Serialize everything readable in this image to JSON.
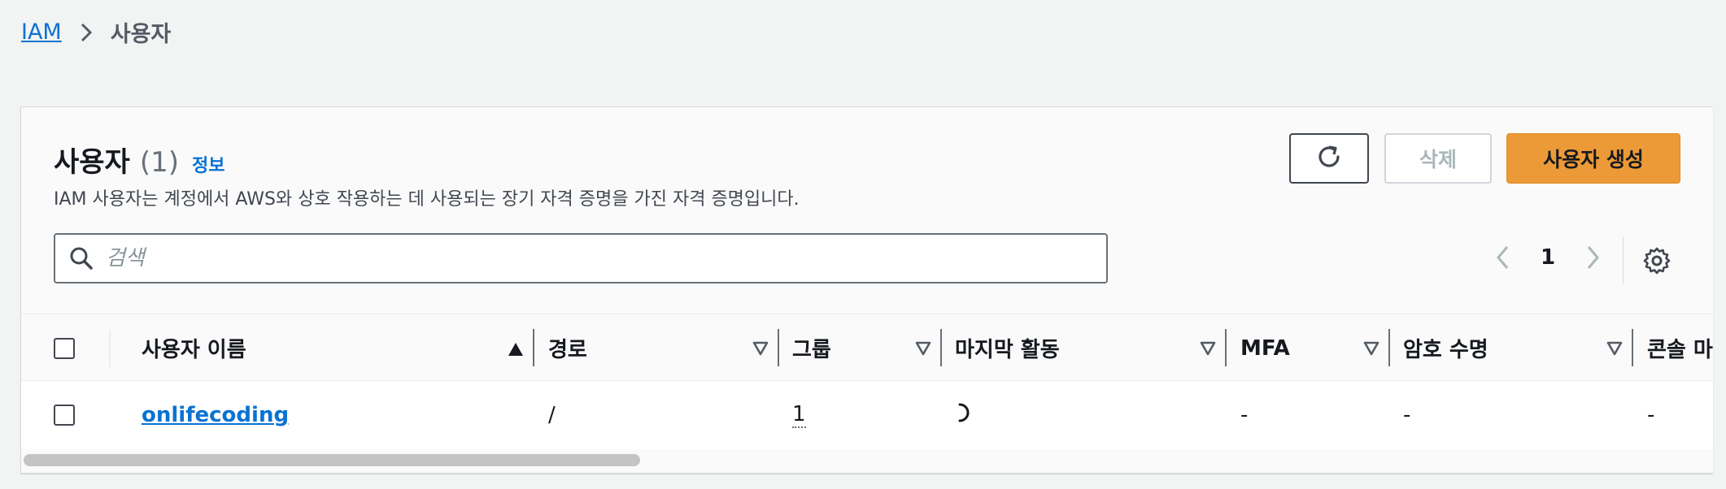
{
  "breadcrumb": {
    "root": "IAM",
    "current": "사용자"
  },
  "panel": {
    "title": "사용자",
    "count": "(1)",
    "info_link": "정보",
    "description": "IAM 사용자는 계정에서 AWS와 상호 작용하는 데 사용되는 장기 자격 증명을 가진 자격 증명입니다."
  },
  "actions": {
    "refresh_icon": "refresh-icon",
    "delete_label": "삭제",
    "create_label": "사용자 생성"
  },
  "search": {
    "placeholder": "검색",
    "value": ""
  },
  "pagination": {
    "current_page": "1"
  },
  "table": {
    "columns": [
      {
        "label": "사용자 이름",
        "sort": "ascending"
      },
      {
        "label": "경로",
        "sort": "none"
      },
      {
        "label": "그룹",
        "sort": "none"
      },
      {
        "label": "마지막 활동",
        "sort": "none"
      },
      {
        "label": "MFA",
        "sort": "none"
      },
      {
        "label": "암호 수명",
        "sort": "none"
      },
      {
        "label": "콘솔 마"
      }
    ],
    "rows": [
      {
        "user_name": "onlifecoding",
        "path": "/",
        "groups": "1",
        "last_activity": "",
        "mfa": "-",
        "password_age": "-",
        "console": "-"
      }
    ]
  },
  "colors": {
    "accent": "#0972d3",
    "primary_button": "#ec9a37",
    "background": "#f2f3f3"
  }
}
